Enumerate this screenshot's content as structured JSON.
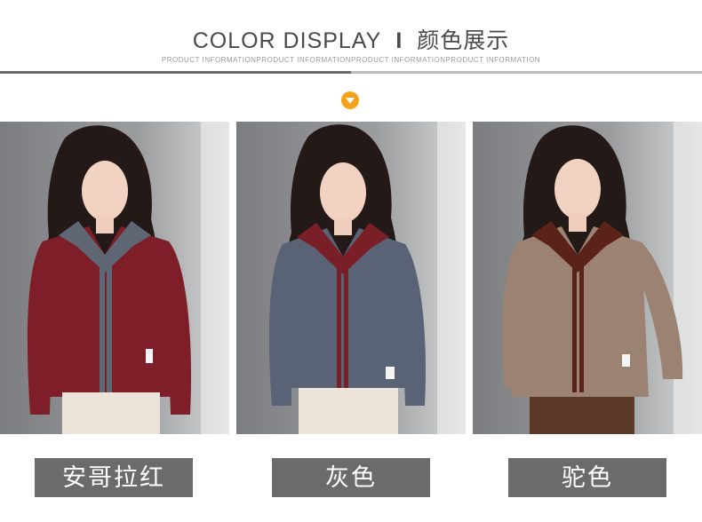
{
  "header": {
    "title_en": "COLOR DISPLAY",
    "separator": "I",
    "title_cn": "颜色展示",
    "subtitle": "PRODUCT INFORMATIONPRODUCT INFORMATIONPRODUCT INFORMATIONPRODUCT INFORMATION"
  },
  "colors": {
    "accent": "#f5a21b",
    "label_bg": "#6b6b6b"
  },
  "products": [
    {
      "label": "安哥拉红",
      "body_color": "#7d1e28",
      "collar_color": "#5f6775"
    },
    {
      "label": "灰色",
      "body_color": "#5a6275",
      "collar_color": "#7a1f28"
    },
    {
      "label": "驼色",
      "body_color": "#9b8272",
      "collar_color": "#5a2218"
    }
  ]
}
